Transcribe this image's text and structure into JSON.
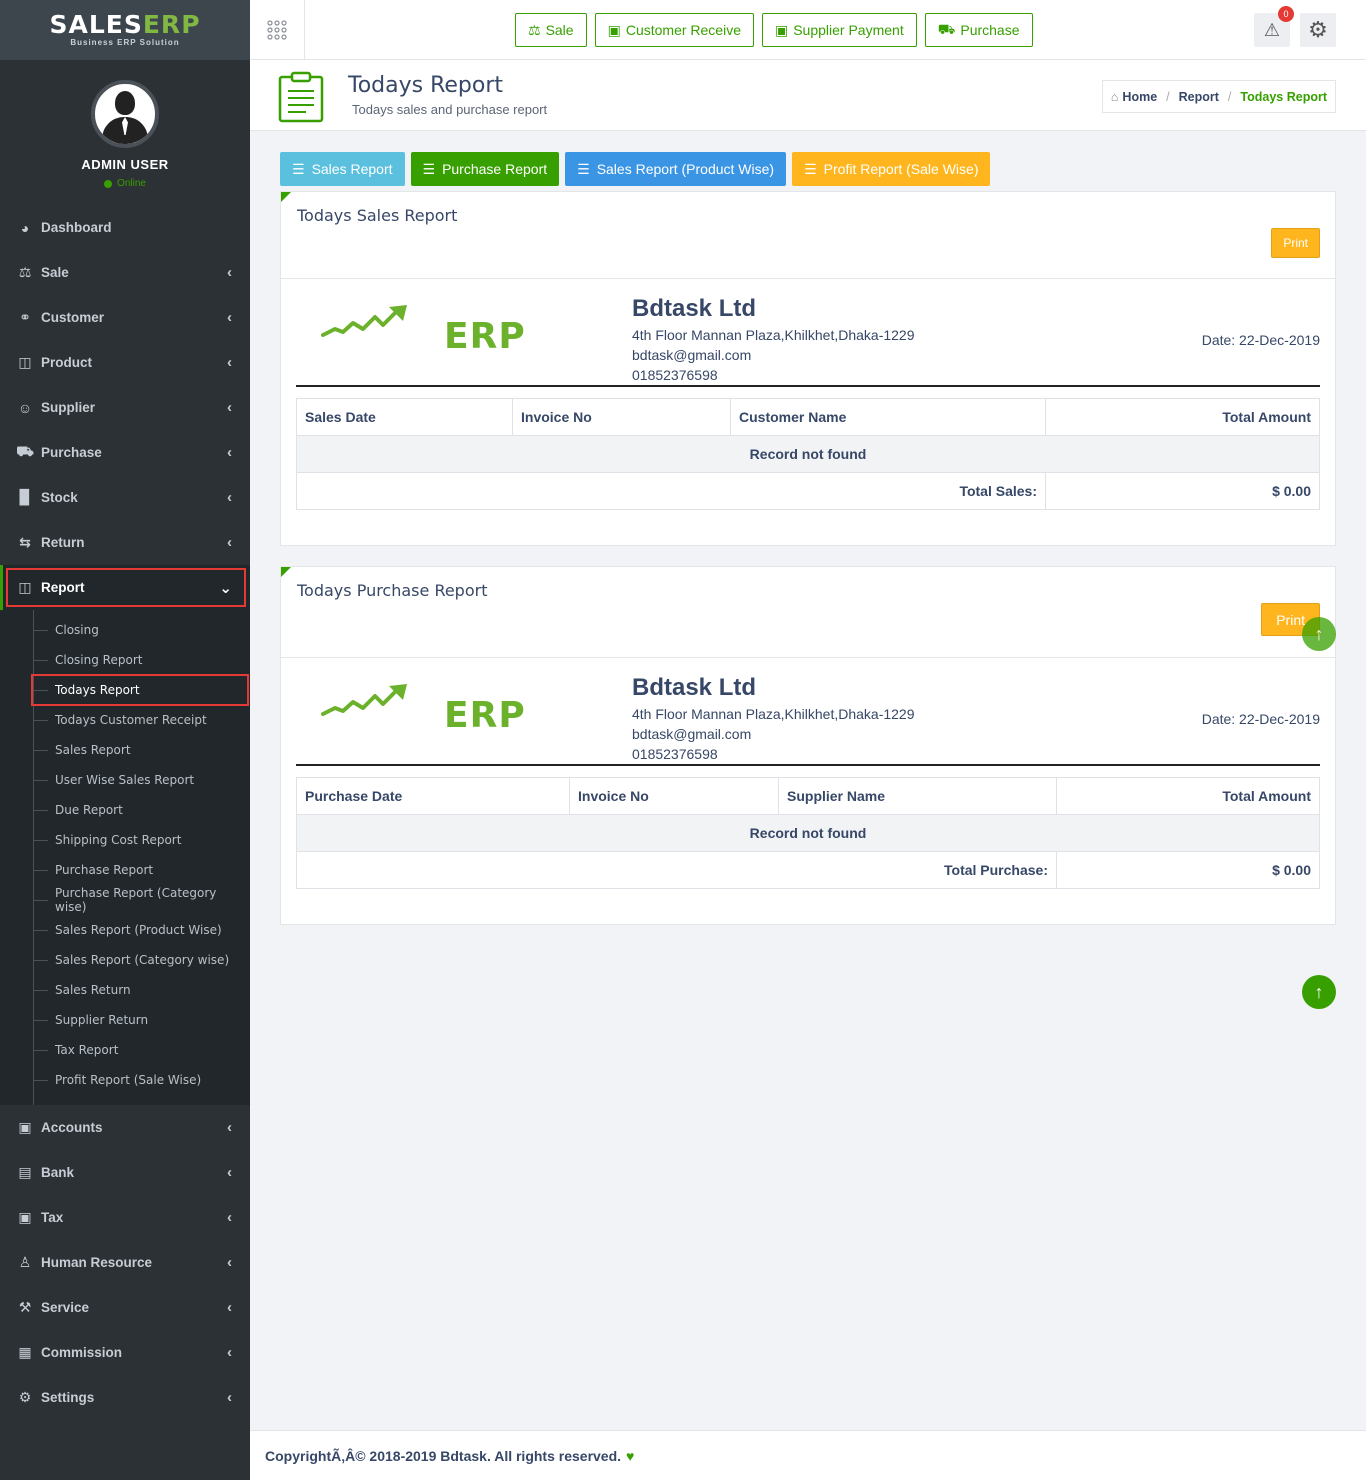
{
  "brand": {
    "logo_sales": "SALES",
    "logo_erp": "ERP",
    "tagline": "Business ERP Solution"
  },
  "user": {
    "name": "ADMIN USER",
    "status": "Online"
  },
  "sidebar": {
    "items": [
      {
        "label": "Dashboard",
        "icon": "dashboard-icon"
      },
      {
        "label": "Sale",
        "icon": "balance-scale-icon"
      },
      {
        "label": "Customer",
        "icon": "handshake-icon"
      },
      {
        "label": "Product",
        "icon": "bag-icon"
      },
      {
        "label": "Supplier",
        "icon": "user-icon"
      },
      {
        "label": "Purchase",
        "icon": "cart-icon"
      },
      {
        "label": "Stock",
        "icon": "bar-chart-icon"
      },
      {
        "label": "Return",
        "icon": "exchange-icon"
      },
      {
        "label": "Report",
        "icon": "book-icon"
      },
      {
        "label": "Accounts",
        "icon": "money-icon"
      },
      {
        "label": "Bank",
        "icon": "bank-icon"
      },
      {
        "label": "Tax",
        "icon": "money-icon"
      },
      {
        "label": "Human Resource",
        "icon": "users-icon"
      },
      {
        "label": "Service",
        "icon": "wrench-icon"
      },
      {
        "label": "Commission",
        "icon": "grid-icon"
      },
      {
        "label": "Settings",
        "icon": "gear-icon"
      }
    ],
    "report_submenu": [
      "Closing",
      "Closing Report",
      "Todays Report",
      "Todays Customer Receipt",
      "Sales Report",
      "User Wise Sales Report",
      "Due Report",
      "Shipping Cost Report",
      "Purchase Report",
      "Purchase Report (Category wise)",
      "Sales Report (Product Wise)",
      "Sales Report (Category wise)",
      "Sales Return",
      "Supplier Return",
      "Tax Report",
      "Profit Report (Sale Wise)"
    ]
  },
  "topbar": {
    "quick_buttons": [
      {
        "label": "Sale",
        "icon": "balance-scale-icon"
      },
      {
        "label": "Customer Receive",
        "icon": "money-icon"
      },
      {
        "label": "Supplier Payment",
        "icon": "money-icon"
      },
      {
        "label": "Purchase",
        "icon": "cart-icon"
      }
    ],
    "alert_count": "0"
  },
  "page": {
    "title": "Todays Report",
    "subtitle": "Todays sales and purchase report",
    "breadcrumb": [
      "Home",
      "Report",
      "Todays Report"
    ]
  },
  "report_buttons": [
    {
      "label": "Sales Report",
      "color": "#5bc0de"
    },
    {
      "label": "Purchase Report",
      "color": "#37a000"
    },
    {
      "label": "Sales Report (Product Wise)",
      "color": "#3a95e4"
    },
    {
      "label": "Profit Report (Sale Wise)",
      "color": "#ffb61e"
    }
  ],
  "company": {
    "logo_text": "ERP",
    "name": "Bdtask Ltd",
    "address": "4th Floor Mannan Plaza,Khilkhet,Dhaka-1229",
    "email": "bdtask@gmail.com",
    "phone": "01852376598",
    "date": "Date: 22-Dec-2019"
  },
  "sales_report": {
    "title": "Todays Sales Report",
    "print_label": "Print",
    "columns": [
      "Sales Date",
      "Invoice No",
      "Customer Name",
      "Total Amount"
    ],
    "empty_text": "Record not found",
    "total_label": "Total Sales:",
    "total_value": "$ 0.00"
  },
  "purchase_report": {
    "title": "Todays Purchase Report",
    "print_label": "Print",
    "columns": [
      "Purchase Date",
      "Invoice No",
      "Supplier Name",
      "Total Amount"
    ],
    "empty_text": "Record not found",
    "total_label": "Total Purchase:",
    "total_value": "$ 0.00"
  },
  "footer": {
    "text": "CopyrightÃ‚Â© 2018-2019 Bdtask. All rights reserved."
  },
  "colors": {
    "accent": "#37a000",
    "sidebar_bg": "#2c3136",
    "warning": "#ffb61e",
    "highlight": "#e53935"
  }
}
